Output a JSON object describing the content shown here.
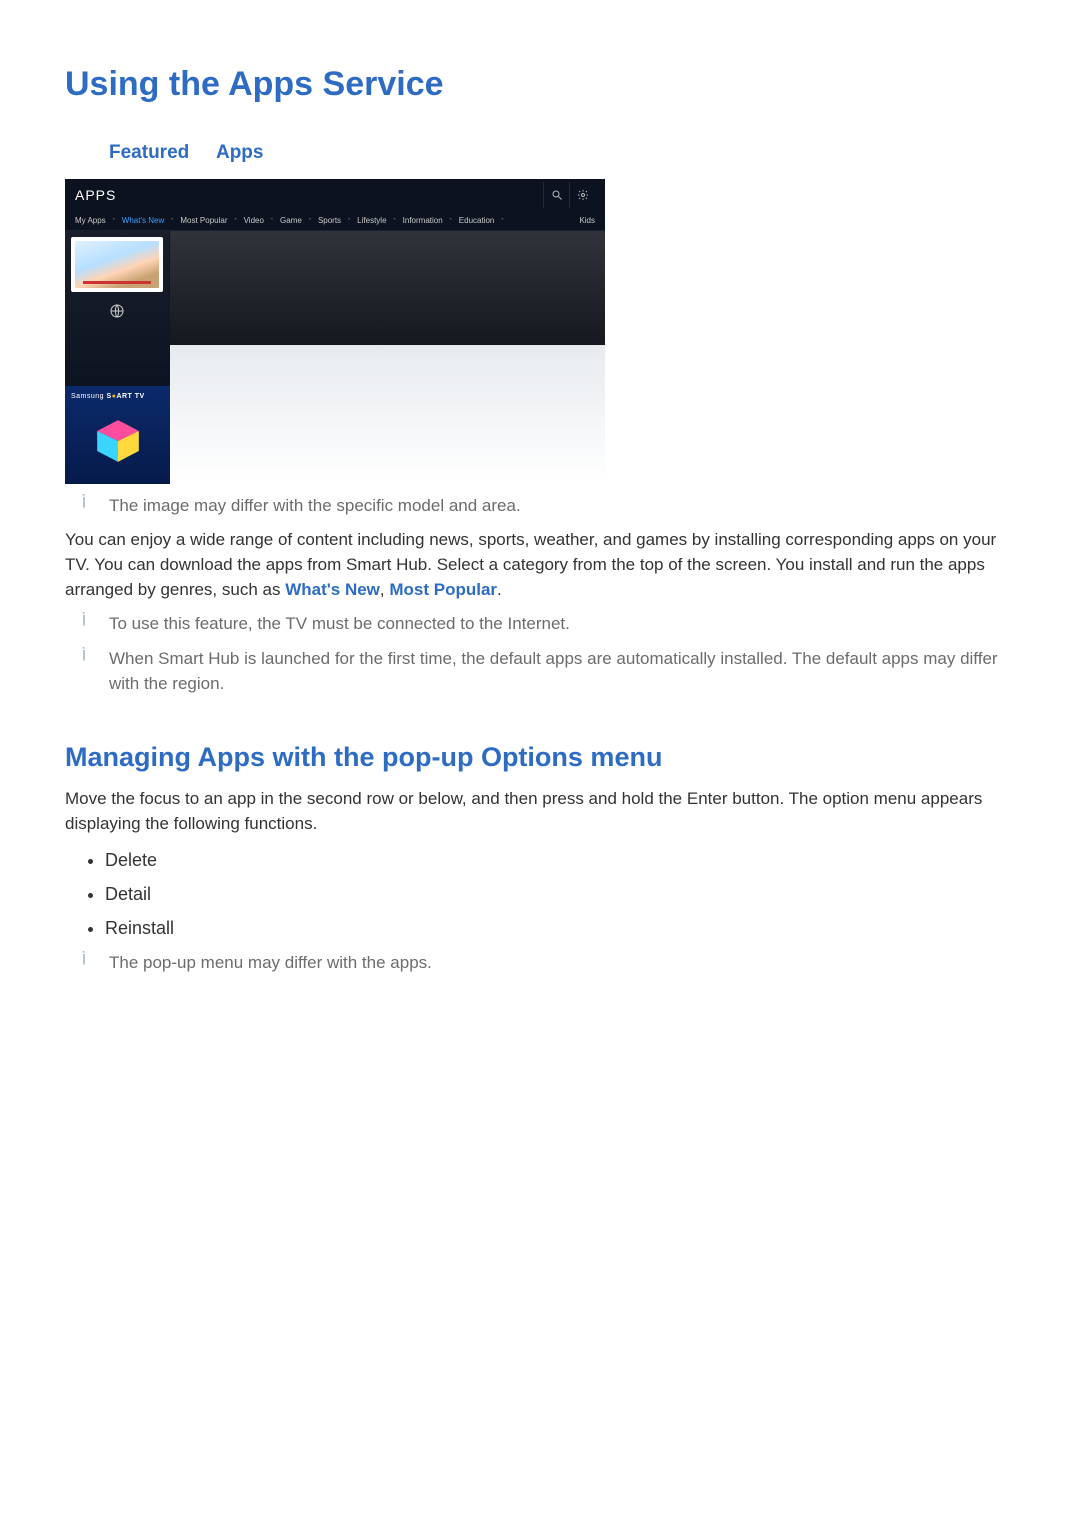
{
  "title": "Using the Apps Service",
  "breadcrumb": {
    "item1": "Featured",
    "item2": "Apps"
  },
  "screenshot": {
    "header_title": "APPS",
    "search_icon_name": "search-icon",
    "settings_icon_name": "settings-icon",
    "tabs": {
      "my_apps": "My Apps",
      "whats_new": "What's New",
      "most_popular": "Most Popular",
      "video": "Video",
      "game": "Game",
      "sports": "Sports",
      "lifestyle": "Lifestyle",
      "information": "Information",
      "education": "Education",
      "kids": "Kids"
    },
    "smarttv_prefix": "Samsung ",
    "smarttv_s": "S",
    "smarttv_rest": "ART TV"
  },
  "note1": "The image may differ with the specific model and area.",
  "para1_a": "You can enjoy a wide range of content including news, sports, weather, and games by installing corresponding apps on your TV. You can download the apps from Smart Hub. Select a category from the top of the screen. You install and run the apps arranged by genres, such as ",
  "hl1": "What's New",
  "para1_sep": ", ",
  "hl2": "Most Popular",
  "para1_end": ".",
  "note2": "To use this feature, the TV must be connected to the Internet.",
  "note3": "When Smart Hub is launched for the first time, the default apps are automatically installed. The default apps may differ with the region.",
  "h2": "Managing Apps with the pop-up Options menu",
  "para2": "Move the focus to an app in the second row or below, and then press and hold the Enter button. The option menu appears displaying the following functions.",
  "options": {
    "o1": "Delete",
    "o2": "Detail",
    "o3": "Reinstall"
  },
  "note4": "The pop-up menu may differ with the apps."
}
